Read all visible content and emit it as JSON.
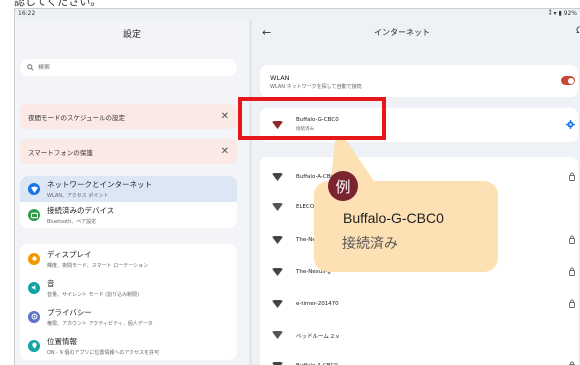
{
  "caption": "認してください。",
  "status_bar": {
    "time": "16:22",
    "icons": "⁑ ▾ ▮ 92%"
  },
  "settings": {
    "title": "設定",
    "search_placeholder": "検索",
    "suggestions": [
      {
        "label": "夜間モードのスケジュールの設定"
      },
      {
        "label": "スマートフォンの保護"
      }
    ],
    "group1": [
      {
        "title": "ネットワークとインターネット",
        "subtitle": "WLAN、アクセス ポイント",
        "icon": "wifi-icon",
        "color": "#1a73e8",
        "selected": true
      },
      {
        "title": "接続済みのデバイス",
        "subtitle": "Bluetooth、ペア設定",
        "icon": "devices-icon",
        "color": "#2e9b4a",
        "selected": false
      }
    ],
    "group2": [
      {
        "title": "ディスプレイ",
        "subtitle": "輝度、夜間モード、スマート ローテーション",
        "icon": "display-icon",
        "color": "#f29900"
      },
      {
        "title": "音",
        "subtitle": "音量、サイレント モード (割り込み制限)",
        "icon": "sound-icon",
        "color": "#12a4a4"
      },
      {
        "title": "プライバシー",
        "subtitle": "権限、アカウント アクティビティ、個人データ",
        "icon": "privacy-icon",
        "color": "#5b73c9"
      },
      {
        "title": "位置情報",
        "subtitle": "ON - 9 個のアプリに位置情報へのアクセスを許可",
        "icon": "location-icon",
        "color": "#12a4a4"
      }
    ]
  },
  "internet": {
    "back_label": "←",
    "title": "インターネット",
    "wlan_title": "WLAN",
    "wlan_subtitle": "WLAN ネットワークを探して自動で接続",
    "wlan_enabled": true,
    "connected": {
      "name": "Buffalo-G-CBC0",
      "status": "接続済み"
    },
    "networks": [
      {
        "name": "Buffalo-A-CBC0",
        "locked": true
      },
      {
        "name": "ELECOM",
        "locked": false
      },
      {
        "name": "The-Nexus",
        "locked": true
      },
      {
        "name": "The-Nexus-g",
        "locked": true
      },
      {
        "name": "e-timer-201470",
        "locked": true
      },
      {
        "name": "ベッドルーム 2.v",
        "locked": false
      },
      {
        "name": "Buffalo-A-CBC0",
        "locked": true
      }
    ]
  },
  "callout": {
    "badge": "例",
    "name": "Buffalo-G-CBC0",
    "status": "接続済み"
  },
  "colors": {
    "accent_red": "#e41818",
    "callout_bg": "#fde0b4",
    "badge_bg": "#7a2430",
    "toggle_on": "#c64a3a",
    "wifi_connected": "#8b2a2a"
  }
}
